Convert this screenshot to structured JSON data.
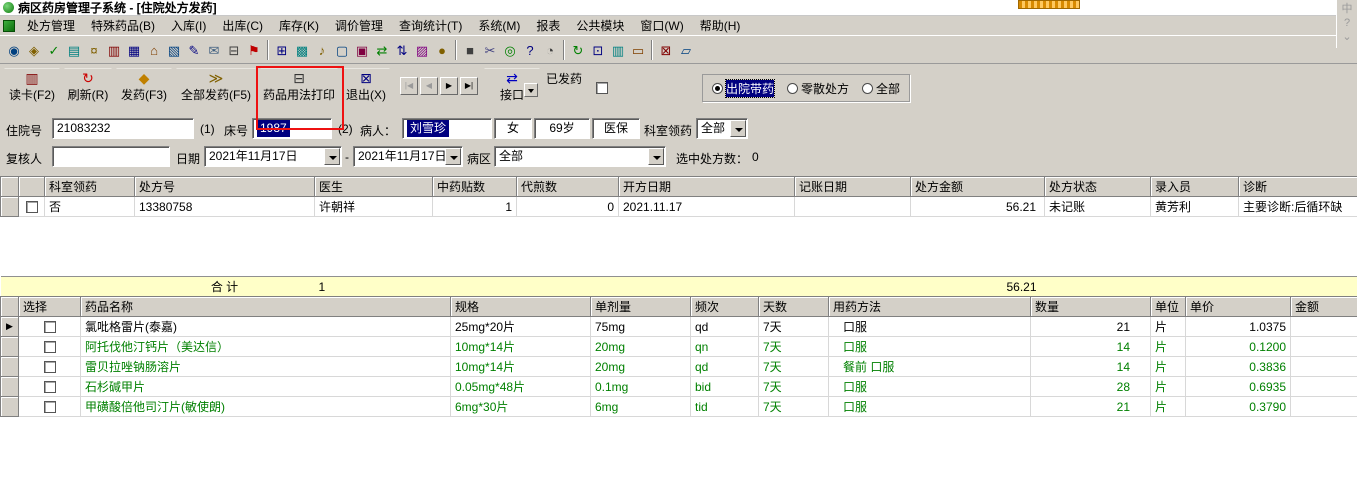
{
  "title_bar": {
    "title": "病区药房管理子系统 - [住院处方发药]"
  },
  "ime": {
    "lang": "中",
    "help": "?",
    "collapse": "⌄"
  },
  "menu": {
    "items": [
      "处方管理",
      "特殊药品(B)",
      "入库(I)",
      "出库(C)",
      "库存(K)",
      "调价管理",
      "查询统计(T)",
      "系统(M)",
      "报表",
      "公共模块",
      "窗口(W)",
      "帮助(H)"
    ]
  },
  "toolbar_icons": [
    [
      {
        "name": "search-icon",
        "glyph": "◉",
        "color": "#004080"
      },
      {
        "name": "audit-icon",
        "glyph": "◈",
        "color": "#806000"
      },
      {
        "name": "approve-icon",
        "glyph": "✓",
        "color": "#008000"
      },
      {
        "name": "stats-icon",
        "glyph": "▤",
        "color": "#008080"
      },
      {
        "name": "fee-icon",
        "glyph": "¤",
        "color": "#806000"
      },
      {
        "name": "card-icon",
        "glyph": "▥",
        "color": "#800000"
      },
      {
        "name": "save-icon",
        "glyph": "▦",
        "color": "#000080"
      },
      {
        "name": "home-icon",
        "glyph": "⌂",
        "color": "#804000"
      },
      {
        "name": "document-icon",
        "glyph": "▧",
        "color": "#004080"
      },
      {
        "name": "edit-icon",
        "glyph": "✎",
        "color": "#000080"
      },
      {
        "name": "mail-icon",
        "glyph": "✉",
        "color": "#406080"
      },
      {
        "name": "print-icon",
        "glyph": "⊟",
        "color": "#404040"
      },
      {
        "name": "flag-icon",
        "glyph": "⚑",
        "color": "#c00000"
      }
    ],
    [
      {
        "name": "calc-icon",
        "glyph": "⊞",
        "color": "#000080"
      },
      {
        "name": "table-icon",
        "glyph": "▩",
        "color": "#008080"
      },
      {
        "name": "alarm-icon",
        "glyph": "♪",
        "color": "#806000"
      },
      {
        "name": "monitor-icon",
        "glyph": "▢",
        "color": "#004080"
      },
      {
        "name": "book-icon",
        "glyph": "▣",
        "color": "#800040"
      },
      {
        "name": "export-icon",
        "glyph": "⇄",
        "color": "#008000"
      },
      {
        "name": "import-icon",
        "glyph": "⇅",
        "color": "#000080"
      },
      {
        "name": "chart-icon",
        "glyph": "▨",
        "color": "#800080"
      },
      {
        "name": "coins-icon",
        "glyph": "●",
        "color": "#806000"
      }
    ],
    [
      {
        "name": "lock-icon",
        "glyph": "■",
        "color": "#404040"
      },
      {
        "name": "scissors-icon",
        "glyph": "✂",
        "color": "#404080"
      },
      {
        "name": "globe-icon",
        "glyph": "◎",
        "color": "#008000"
      },
      {
        "name": "help-icon",
        "glyph": "?",
        "color": "#000080"
      },
      {
        "name": "zoom-icon",
        "glyph": "◔",
        "color": "#404040"
      }
    ],
    [
      {
        "name": "refresh-small-icon",
        "glyph": "↻",
        "color": "#008000"
      },
      {
        "name": "layout-icon",
        "glyph": "⊡",
        "color": "#000080"
      },
      {
        "name": "columns-icon",
        "glyph": "▥",
        "color": "#008080"
      },
      {
        "name": "window-icon",
        "glyph": "▭",
        "color": "#804000"
      }
    ],
    [
      {
        "name": "close-icon",
        "glyph": "⊠",
        "color": "#800000"
      },
      {
        "name": "sheet-icon",
        "glyph": "▱",
        "color": "#004080"
      }
    ]
  ],
  "action_bar": {
    "buttons": [
      {
        "name": "read-card",
        "label": "读卡(F2)",
        "glyph": "▥",
        "color": "#800000"
      },
      {
        "name": "refresh",
        "label": "刷新(R)",
        "glyph": "↻",
        "color": "#cc0000"
      },
      {
        "name": "dispense",
        "label": "发药(F3)",
        "glyph": "◆",
        "color": "#c08000"
      },
      {
        "name": "dispense-all",
        "label": "全部发药(F5)",
        "glyph": "≫",
        "color": "#806000"
      },
      {
        "name": "print-usage",
        "label": "药品用法打印",
        "glyph": "⊟",
        "color": "#333333"
      },
      {
        "name": "exit",
        "label": "退出(X)",
        "glyph": "⊠",
        "color": "#000080"
      }
    ],
    "nav": [
      {
        "name": "first",
        "glyph": "|◀",
        "disabled": true
      },
      {
        "name": "prev",
        "glyph": "◀",
        "disabled": true
      },
      {
        "name": "next",
        "glyph": "▶",
        "disabled": false
      },
      {
        "name": "last",
        "glyph": "▶|",
        "disabled": false
      }
    ],
    "interface": {
      "label": "接口",
      "glyph": "⇄",
      "color": "#0000c0"
    },
    "dispensed_label": "已发药",
    "radios": [
      "出院带药",
      "零散处方",
      "全部"
    ],
    "selected_radio": 0
  },
  "form": {
    "admission_label": "住院号",
    "admission_value": "21083232",
    "seq1": "(1)",
    "bed_label": "床号",
    "bed_value": "1987",
    "seq2": "(2)",
    "patient_label": "病人：",
    "patient_value": "刘雪珍",
    "gender": "女",
    "age": "69岁",
    "insurance": "医保",
    "dept_label": "科室领药",
    "dept_value": "全部",
    "reviewer_label": "复核人",
    "reviewer_value": "",
    "date_label": "日期",
    "date_from": "2021年11月17日",
    "date_sep": "-",
    "date_to": "2021年11月17日",
    "ward_label": "病区",
    "ward_value": "全部",
    "selected_count_label": "选中处方数：",
    "selected_count": "0"
  },
  "grid1": {
    "headers": [
      "科室领药",
      "处方号",
      "医生",
      "中药贴数",
      "代煎数",
      "开方日期",
      "记账日期",
      "处方金额",
      "处方状态",
      "录入员",
      "诊断"
    ],
    "row": {
      "dept": "否",
      "rx_no": "13380758",
      "doctor": "许朝祥",
      "herb_count": "1",
      "decoct_count": "0",
      "open_date": "2021.11.17",
      "billing_date": "",
      "amount": "56.21",
      "status": "未记账",
      "operator": "黄芳利",
      "diagnosis": "主要诊断:后循环缺"
    },
    "total": {
      "label": "合  计",
      "count": "1",
      "amount": "56.21"
    }
  },
  "grid2": {
    "headers": [
      "选择",
      "药品名称",
      "规格",
      "单剂量",
      "频次",
      "天数",
      "用药方法",
      "数量",
      "单位",
      "单价",
      "金额"
    ],
    "first_row_color": "#000000",
    "row_color": "#008000",
    "rows": [
      {
        "name": "氯吡格雷片(泰嘉)",
        "spec": "25mg*20片",
        "dose": "75mg",
        "freq": "qd",
        "days": "7天",
        "usage": "口服",
        "qty": "21",
        "unit": "片",
        "price": "1.0375",
        "amount": ""
      },
      {
        "name": "阿托伐他汀钙片（美达信）",
        "spec": "10mg*14片",
        "dose": "20mg",
        "freq": "qn",
        "days": "7天",
        "usage": "口服",
        "qty": "14",
        "unit": "片",
        "price": "0.1200",
        "amount": ""
      },
      {
        "name": "雷贝拉唑钠肠溶片",
        "spec": "10mg*14片",
        "dose": "20mg",
        "freq": "qd",
        "days": "7天",
        "usage": "餐前 口服",
        "qty": "14",
        "unit": "片",
        "price": "0.3836",
        "amount": ""
      },
      {
        "name": "石杉碱甲片",
        "spec": "0.05mg*48片",
        "dose": "0.1mg",
        "freq": "bid",
        "days": "7天",
        "usage": "口服",
        "qty": "28",
        "unit": "片",
        "price": "0.6935",
        "amount": ""
      },
      {
        "name": "甲磺酸倍他司汀片(敏使朗)",
        "spec": "6mg*30片",
        "dose": "6mg",
        "freq": "tid",
        "days": "7天",
        "usage": "口服",
        "qty": "21",
        "unit": "片",
        "price": "0.3790",
        "amount": ""
      }
    ]
  }
}
